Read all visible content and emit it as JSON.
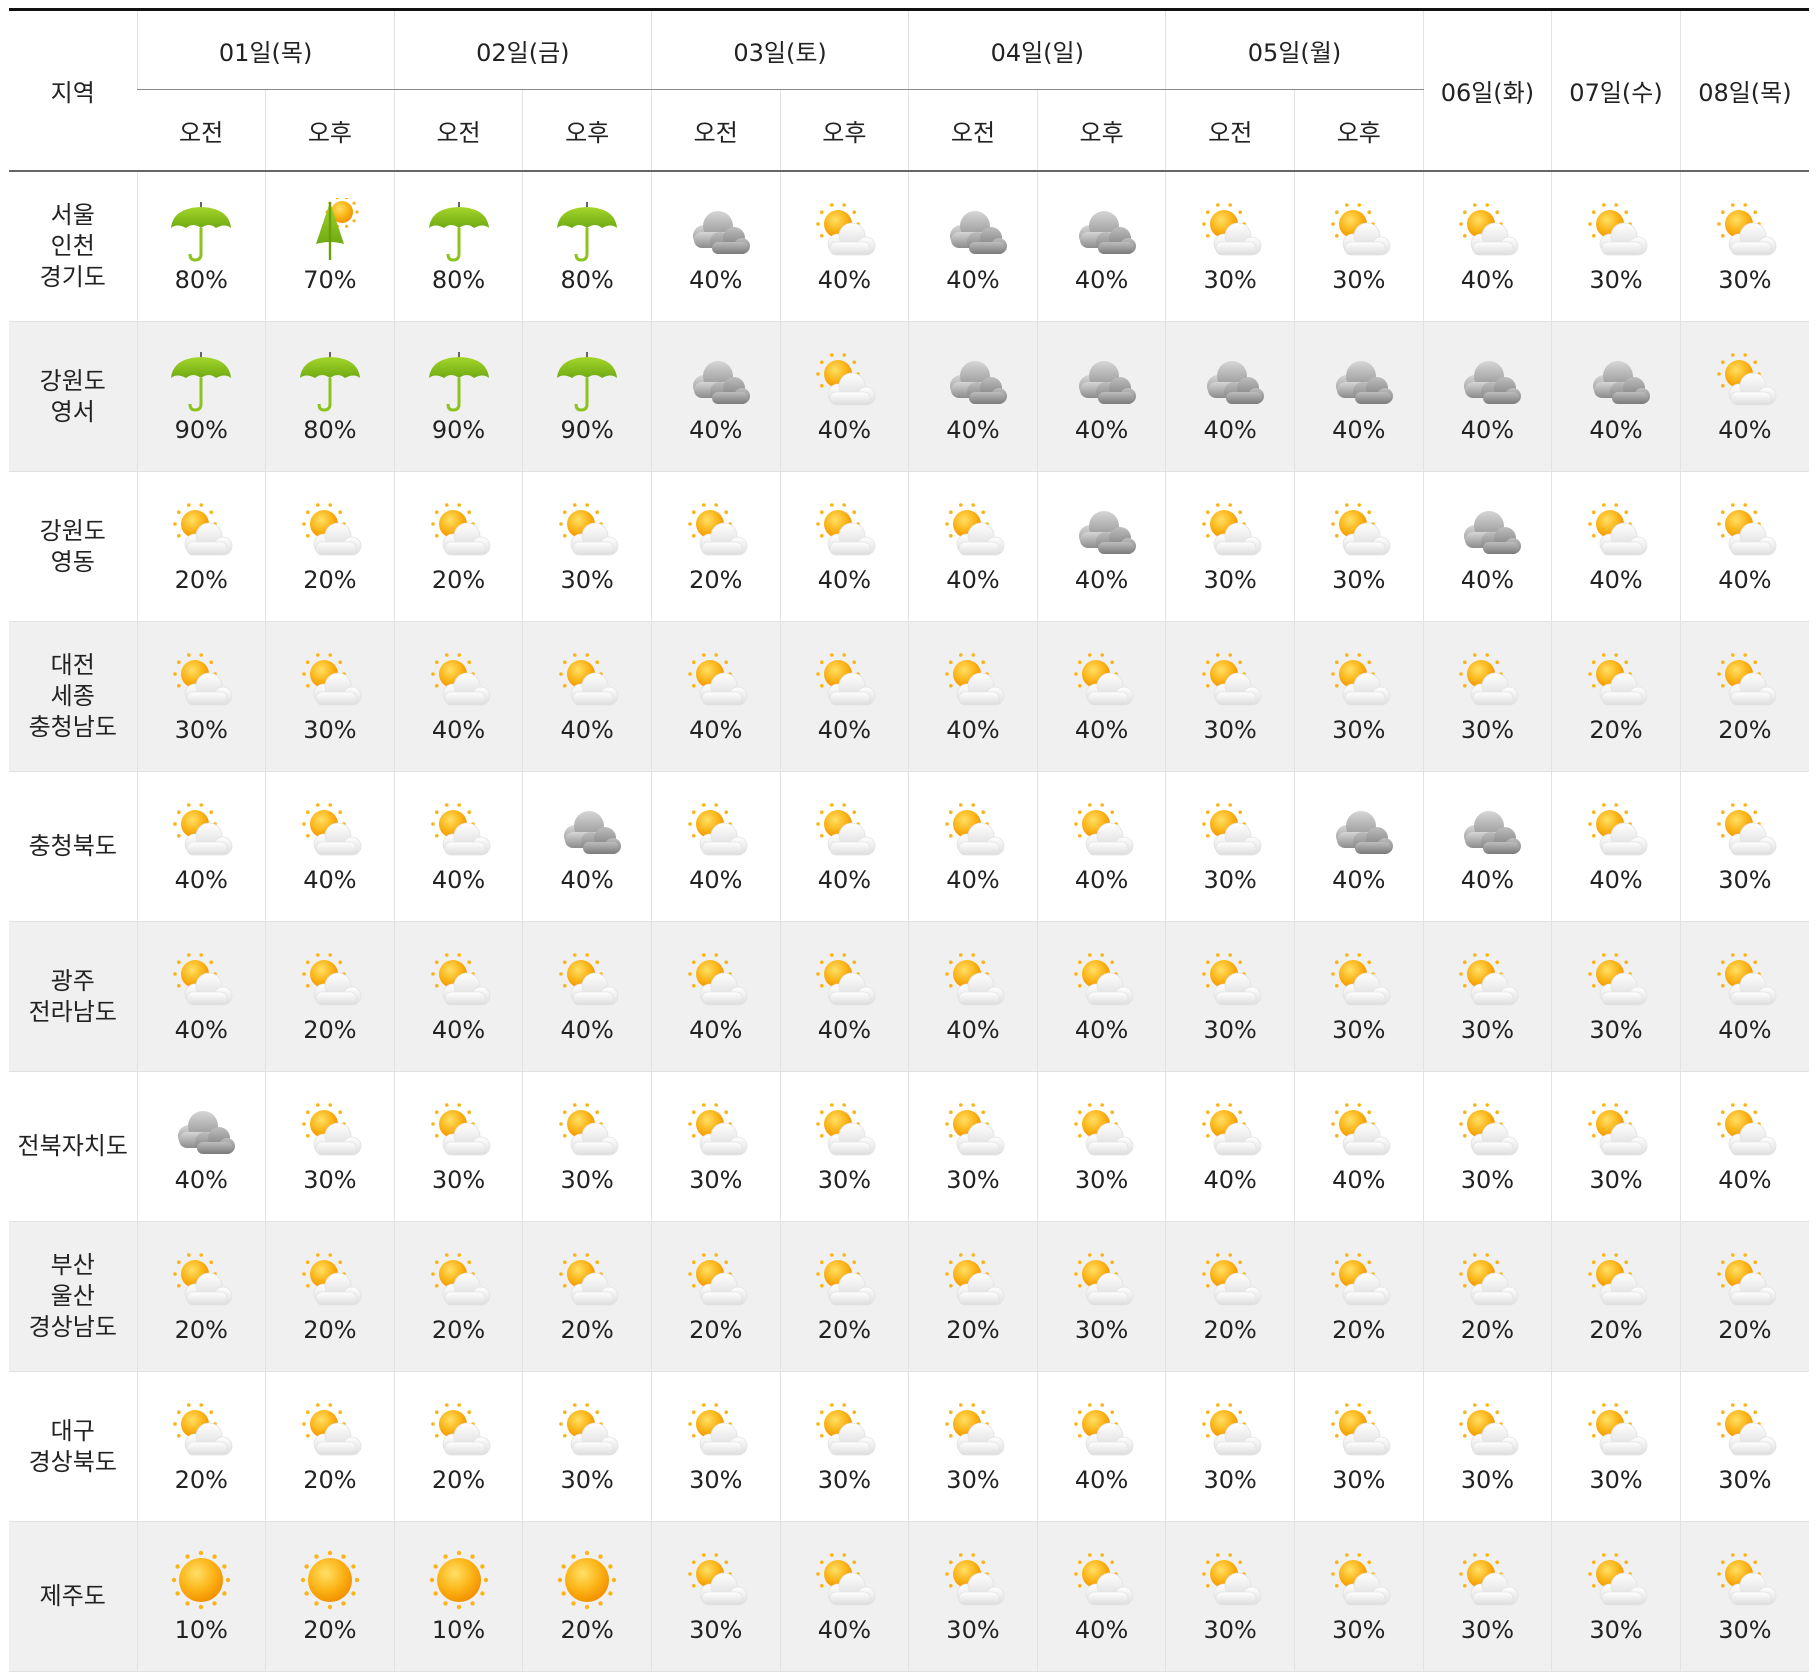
{
  "header": {
    "region_label": "지역",
    "days": [
      {
        "label": "01일(목)",
        "split": true
      },
      {
        "label": "02일(금)",
        "split": true
      },
      {
        "label": "03일(토)",
        "split": true
      },
      {
        "label": "04일(일)",
        "split": true
      },
      {
        "label": "05일(월)",
        "split": true
      },
      {
        "label": "06일(화)",
        "split": false
      },
      {
        "label": "07일(수)",
        "split": false
      },
      {
        "label": "08일(목)",
        "split": false
      }
    ],
    "am_label": "오전",
    "pm_label": "오후"
  },
  "rows": [
    {
      "region": "서울\n인천\n경기도",
      "cells": [
        {
          "icon": "umbrella-icon",
          "value": "80%"
        },
        {
          "icon": "umbrella-sun-icon",
          "value": "70%"
        },
        {
          "icon": "umbrella-icon",
          "value": "80%"
        },
        {
          "icon": "umbrella-icon",
          "value": "80%"
        },
        {
          "icon": "cloudy-icon",
          "value": "40%"
        },
        {
          "icon": "partly-cloudy-icon",
          "value": "40%"
        },
        {
          "icon": "cloudy-icon",
          "value": "40%"
        },
        {
          "icon": "cloudy-icon",
          "value": "40%"
        },
        {
          "icon": "partly-cloudy-icon",
          "value": "30%"
        },
        {
          "icon": "partly-cloudy-icon",
          "value": "30%"
        },
        {
          "icon": "partly-cloudy-icon",
          "value": "40%"
        },
        {
          "icon": "partly-cloudy-icon",
          "value": "30%"
        },
        {
          "icon": "partly-cloudy-icon",
          "value": "30%"
        }
      ]
    },
    {
      "region": "강원도\n영서",
      "cells": [
        {
          "icon": "umbrella-icon",
          "value": "90%"
        },
        {
          "icon": "umbrella-icon",
          "value": "80%"
        },
        {
          "icon": "umbrella-icon",
          "value": "90%"
        },
        {
          "icon": "umbrella-icon",
          "value": "90%"
        },
        {
          "icon": "cloudy-icon",
          "value": "40%"
        },
        {
          "icon": "partly-cloudy-icon",
          "value": "40%"
        },
        {
          "icon": "cloudy-icon",
          "value": "40%"
        },
        {
          "icon": "cloudy-icon",
          "value": "40%"
        },
        {
          "icon": "cloudy-icon",
          "value": "40%"
        },
        {
          "icon": "cloudy-icon",
          "value": "40%"
        },
        {
          "icon": "cloudy-icon",
          "value": "40%"
        },
        {
          "icon": "cloudy-icon",
          "value": "40%"
        },
        {
          "icon": "partly-cloudy-icon",
          "value": "40%"
        }
      ]
    },
    {
      "region": "강원도\n영동",
      "cells": [
        {
          "icon": "partly-cloudy-icon",
          "value": "20%"
        },
        {
          "icon": "partly-cloudy-icon",
          "value": "20%"
        },
        {
          "icon": "partly-cloudy-icon",
          "value": "20%"
        },
        {
          "icon": "partly-cloudy-icon",
          "value": "30%"
        },
        {
          "icon": "partly-cloudy-icon",
          "value": "20%"
        },
        {
          "icon": "partly-cloudy-icon",
          "value": "40%"
        },
        {
          "icon": "partly-cloudy-icon",
          "value": "40%"
        },
        {
          "icon": "cloudy-icon",
          "value": "40%"
        },
        {
          "icon": "partly-cloudy-icon",
          "value": "30%"
        },
        {
          "icon": "partly-cloudy-icon",
          "value": "30%"
        },
        {
          "icon": "cloudy-icon",
          "value": "40%"
        },
        {
          "icon": "partly-cloudy-icon",
          "value": "40%"
        },
        {
          "icon": "partly-cloudy-icon",
          "value": "40%"
        }
      ]
    },
    {
      "region": "대전\n세종\n충청남도",
      "cells": [
        {
          "icon": "partly-cloudy-icon",
          "value": "30%"
        },
        {
          "icon": "partly-cloudy-icon",
          "value": "30%"
        },
        {
          "icon": "partly-cloudy-icon",
          "value": "40%"
        },
        {
          "icon": "partly-cloudy-icon",
          "value": "40%"
        },
        {
          "icon": "partly-cloudy-icon",
          "value": "40%"
        },
        {
          "icon": "partly-cloudy-icon",
          "value": "40%"
        },
        {
          "icon": "partly-cloudy-icon",
          "value": "40%"
        },
        {
          "icon": "partly-cloudy-icon",
          "value": "40%"
        },
        {
          "icon": "partly-cloudy-icon",
          "value": "30%"
        },
        {
          "icon": "partly-cloudy-icon",
          "value": "30%"
        },
        {
          "icon": "partly-cloudy-icon",
          "value": "30%"
        },
        {
          "icon": "partly-cloudy-icon",
          "value": "20%"
        },
        {
          "icon": "partly-cloudy-icon",
          "value": "20%"
        }
      ]
    },
    {
      "region": "충청북도",
      "cells": [
        {
          "icon": "partly-cloudy-icon",
          "value": "40%"
        },
        {
          "icon": "partly-cloudy-icon",
          "value": "40%"
        },
        {
          "icon": "partly-cloudy-icon",
          "value": "40%"
        },
        {
          "icon": "cloudy-icon",
          "value": "40%"
        },
        {
          "icon": "partly-cloudy-icon",
          "value": "40%"
        },
        {
          "icon": "partly-cloudy-icon",
          "value": "40%"
        },
        {
          "icon": "partly-cloudy-icon",
          "value": "40%"
        },
        {
          "icon": "partly-cloudy-icon",
          "value": "40%"
        },
        {
          "icon": "partly-cloudy-icon",
          "value": "30%"
        },
        {
          "icon": "cloudy-icon",
          "value": "40%"
        },
        {
          "icon": "cloudy-icon",
          "value": "40%"
        },
        {
          "icon": "partly-cloudy-icon",
          "value": "40%"
        },
        {
          "icon": "partly-cloudy-icon",
          "value": "30%"
        }
      ]
    },
    {
      "region": "광주\n전라남도",
      "cells": [
        {
          "icon": "partly-cloudy-icon",
          "value": "40%"
        },
        {
          "icon": "partly-cloudy-icon",
          "value": "20%"
        },
        {
          "icon": "partly-cloudy-icon",
          "value": "40%"
        },
        {
          "icon": "partly-cloudy-icon",
          "value": "40%"
        },
        {
          "icon": "partly-cloudy-icon",
          "value": "40%"
        },
        {
          "icon": "partly-cloudy-icon",
          "value": "40%"
        },
        {
          "icon": "partly-cloudy-icon",
          "value": "40%"
        },
        {
          "icon": "partly-cloudy-icon",
          "value": "40%"
        },
        {
          "icon": "partly-cloudy-icon",
          "value": "30%"
        },
        {
          "icon": "partly-cloudy-icon",
          "value": "30%"
        },
        {
          "icon": "partly-cloudy-icon",
          "value": "30%"
        },
        {
          "icon": "partly-cloudy-icon",
          "value": "30%"
        },
        {
          "icon": "partly-cloudy-icon",
          "value": "40%"
        }
      ]
    },
    {
      "region": "전북자치도",
      "cells": [
        {
          "icon": "cloudy-icon",
          "value": "40%"
        },
        {
          "icon": "partly-cloudy-icon",
          "value": "30%"
        },
        {
          "icon": "partly-cloudy-icon",
          "value": "30%"
        },
        {
          "icon": "partly-cloudy-icon",
          "value": "30%"
        },
        {
          "icon": "partly-cloudy-icon",
          "value": "30%"
        },
        {
          "icon": "partly-cloudy-icon",
          "value": "30%"
        },
        {
          "icon": "partly-cloudy-icon",
          "value": "30%"
        },
        {
          "icon": "partly-cloudy-icon",
          "value": "30%"
        },
        {
          "icon": "partly-cloudy-icon",
          "value": "40%"
        },
        {
          "icon": "partly-cloudy-icon",
          "value": "40%"
        },
        {
          "icon": "partly-cloudy-icon",
          "value": "30%"
        },
        {
          "icon": "partly-cloudy-icon",
          "value": "30%"
        },
        {
          "icon": "partly-cloudy-icon",
          "value": "40%"
        }
      ]
    },
    {
      "region": "부산\n울산\n경상남도",
      "cells": [
        {
          "icon": "partly-cloudy-icon",
          "value": "20%"
        },
        {
          "icon": "partly-cloudy-icon",
          "value": "20%"
        },
        {
          "icon": "partly-cloudy-icon",
          "value": "20%"
        },
        {
          "icon": "partly-cloudy-icon",
          "value": "20%"
        },
        {
          "icon": "partly-cloudy-icon",
          "value": "20%"
        },
        {
          "icon": "partly-cloudy-icon",
          "value": "20%"
        },
        {
          "icon": "partly-cloudy-icon",
          "value": "20%"
        },
        {
          "icon": "partly-cloudy-icon",
          "value": "30%"
        },
        {
          "icon": "partly-cloudy-icon",
          "value": "20%"
        },
        {
          "icon": "partly-cloudy-icon",
          "value": "20%"
        },
        {
          "icon": "partly-cloudy-icon",
          "value": "20%"
        },
        {
          "icon": "partly-cloudy-icon",
          "value": "20%"
        },
        {
          "icon": "partly-cloudy-icon",
          "value": "20%"
        }
      ]
    },
    {
      "region": "대구\n경상북도",
      "cells": [
        {
          "icon": "partly-cloudy-icon",
          "value": "20%"
        },
        {
          "icon": "partly-cloudy-icon",
          "value": "20%"
        },
        {
          "icon": "partly-cloudy-icon",
          "value": "20%"
        },
        {
          "icon": "partly-cloudy-icon",
          "value": "30%"
        },
        {
          "icon": "partly-cloudy-icon",
          "value": "30%"
        },
        {
          "icon": "partly-cloudy-icon",
          "value": "30%"
        },
        {
          "icon": "partly-cloudy-icon",
          "value": "30%"
        },
        {
          "icon": "partly-cloudy-icon",
          "value": "40%"
        },
        {
          "icon": "partly-cloudy-icon",
          "value": "30%"
        },
        {
          "icon": "partly-cloudy-icon",
          "value": "30%"
        },
        {
          "icon": "partly-cloudy-icon",
          "value": "30%"
        },
        {
          "icon": "partly-cloudy-icon",
          "value": "30%"
        },
        {
          "icon": "partly-cloudy-icon",
          "value": "30%"
        }
      ]
    },
    {
      "region": "제주도",
      "cells": [
        {
          "icon": "sunny-icon",
          "value": "10%"
        },
        {
          "icon": "sunny-icon",
          "value": "20%"
        },
        {
          "icon": "sunny-icon",
          "value": "10%"
        },
        {
          "icon": "sunny-icon",
          "value": "20%"
        },
        {
          "icon": "partly-cloudy-icon",
          "value": "30%"
        },
        {
          "icon": "partly-cloudy-icon",
          "value": "40%"
        },
        {
          "icon": "partly-cloudy-icon",
          "value": "30%"
        },
        {
          "icon": "partly-cloudy-icon",
          "value": "40%"
        },
        {
          "icon": "partly-cloudy-icon",
          "value": "30%"
        },
        {
          "icon": "partly-cloudy-icon",
          "value": "30%"
        },
        {
          "icon": "partly-cloudy-icon",
          "value": "30%"
        },
        {
          "icon": "partly-cloudy-icon",
          "value": "30%"
        },
        {
          "icon": "partly-cloudy-icon",
          "value": "30%"
        }
      ]
    }
  ],
  "colors": {
    "row_shade": "#f0f0f0",
    "umbrella": "#8cc31e",
    "sun": "#f9a825",
    "cloud_gray": "#a9a9a9"
  }
}
